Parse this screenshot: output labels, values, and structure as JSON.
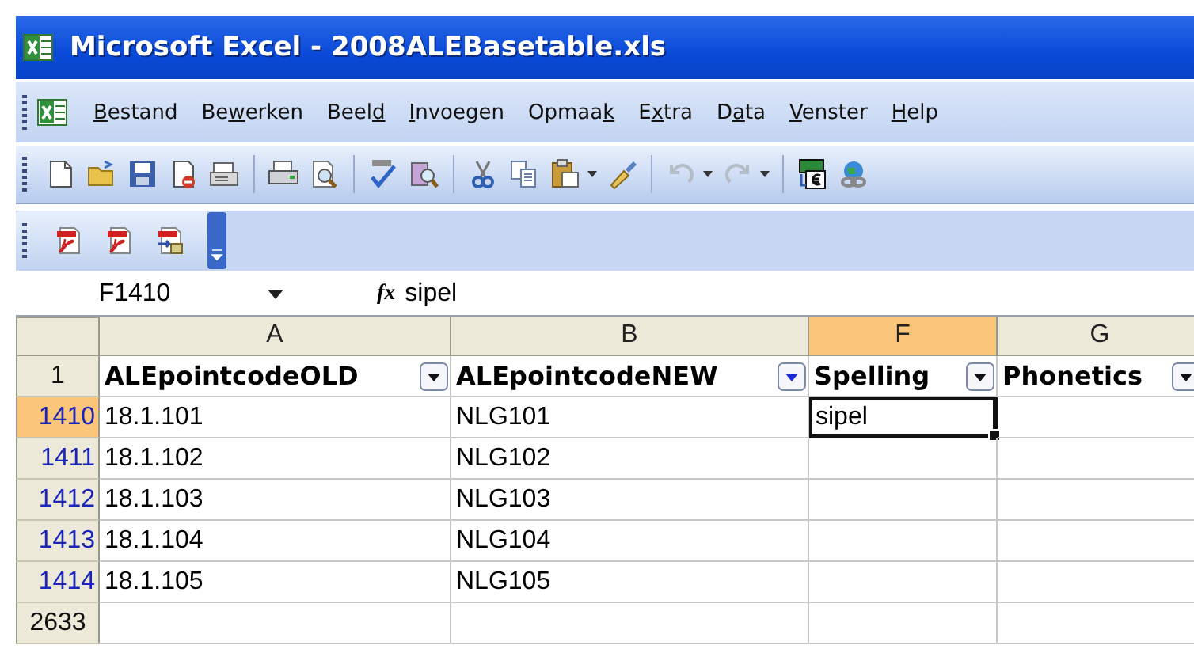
{
  "window": {
    "title": "Microsoft Excel - 2008ALEBasetable.xls"
  },
  "menu": [
    {
      "access_key": "B",
      "after": "estand"
    },
    {
      "before": "Be",
      "access_key": "w",
      "after": "erken"
    },
    {
      "before": "Beel",
      "access_key": "d"
    },
    {
      "access_key": "I",
      "after": "nvoegen"
    },
    {
      "before": "Opmaa",
      "access_key": "k"
    },
    {
      "before": "E",
      "access_key": "x",
      "after": "tra"
    },
    {
      "before": "D",
      "access_key": "a",
      "after": "ta"
    },
    {
      "access_key": "V",
      "after": "enster"
    },
    {
      "access_key": "H",
      "after": "elp"
    }
  ],
  "formula_bar": {
    "name_box": "F1410",
    "fx_label": "fx",
    "value": "sipel"
  },
  "columns": [
    {
      "letter": "A",
      "selected": false
    },
    {
      "letter": "B",
      "selected": false
    },
    {
      "letter": "F",
      "selected": true
    },
    {
      "letter": "G",
      "selected": false
    }
  ],
  "header_row": {
    "number": "1",
    "cells": [
      {
        "text": "ALEpointcodeOLD",
        "filter_active": false
      },
      {
        "text": "ALEpointcodeNEW",
        "filter_active": true
      },
      {
        "text": "Spelling",
        "filter_active": false
      },
      {
        "text": "Phonetics",
        "filter_active": false
      }
    ]
  },
  "rows": [
    {
      "number": "1410",
      "filtered": true,
      "selected": true,
      "cells": [
        {
          "text": "18.1.101",
          "selected": false
        },
        {
          "text": "NLG101",
          "selected": false
        },
        {
          "text": "sipel",
          "selected": true
        },
        {
          "selected": false
        }
      ]
    },
    {
      "number": "1411",
      "filtered": true,
      "selected": false,
      "cells": [
        {
          "text": "18.1.102",
          "selected": false
        },
        {
          "text": "NLG102",
          "selected": false
        },
        {
          "selected": false
        },
        {
          "selected": false
        }
      ]
    },
    {
      "number": "1412",
      "filtered": true,
      "selected": false,
      "cells": [
        {
          "text": "18.1.103",
          "selected": false
        },
        {
          "text": "NLG103",
          "selected": false
        },
        {
          "selected": false
        },
        {
          "selected": false
        }
      ]
    },
    {
      "number": "1413",
      "filtered": true,
      "selected": false,
      "cells": [
        {
          "text": "18.1.104",
          "selected": false
        },
        {
          "text": "NLG104",
          "selected": false
        },
        {
          "selected": false
        },
        {
          "selected": false
        }
      ]
    },
    {
      "number": "1414",
      "filtered": true,
      "selected": false,
      "cells": [
        {
          "text": "18.1.105",
          "selected": false
        },
        {
          "text": "NLG105",
          "selected": false
        },
        {
          "selected": false
        },
        {
          "selected": false
        }
      ]
    },
    {
      "number": "2633",
      "filtered": false,
      "selected": false,
      "cells": [
        {
          "selected": false
        },
        {
          "selected": false
        },
        {
          "selected": false
        },
        {
          "selected": false
        }
      ]
    }
  ]
}
